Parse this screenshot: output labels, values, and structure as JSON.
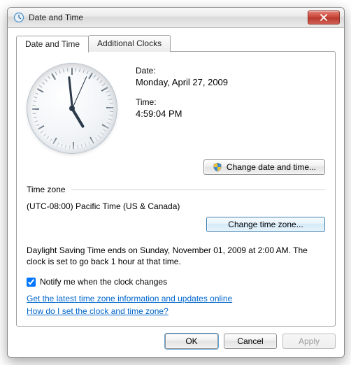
{
  "window": {
    "title": "Date and Time"
  },
  "tabs": {
    "datetime": "Date and Time",
    "additional": "Additional Clocks"
  },
  "datetime": {
    "date_label": "Date:",
    "date_value": "Monday, April 27, 2009",
    "time_label": "Time:",
    "time_value": "4:59:04 PM",
    "change_dt_button": "Change date and time..."
  },
  "timezone": {
    "header": "Time zone",
    "value": "(UTC-08:00) Pacific Time (US & Canada)",
    "change_tz_button": "Change time zone..."
  },
  "dst": {
    "message": "Daylight Saving Time ends on Sunday, November 01, 2009 at 2:00 AM. The clock is set to go back 1 hour at that time.",
    "notify_label": "Notify me when the clock changes",
    "notify_checked": true
  },
  "links": {
    "online": "Get the latest time zone information and updates online",
    "help": "How do I set the clock and time zone?"
  },
  "footer": {
    "ok": "OK",
    "cancel": "Cancel",
    "apply": "Apply"
  },
  "clock": {
    "hour_angle": 149,
    "minute_angle": 354,
    "second_angle": 24
  }
}
